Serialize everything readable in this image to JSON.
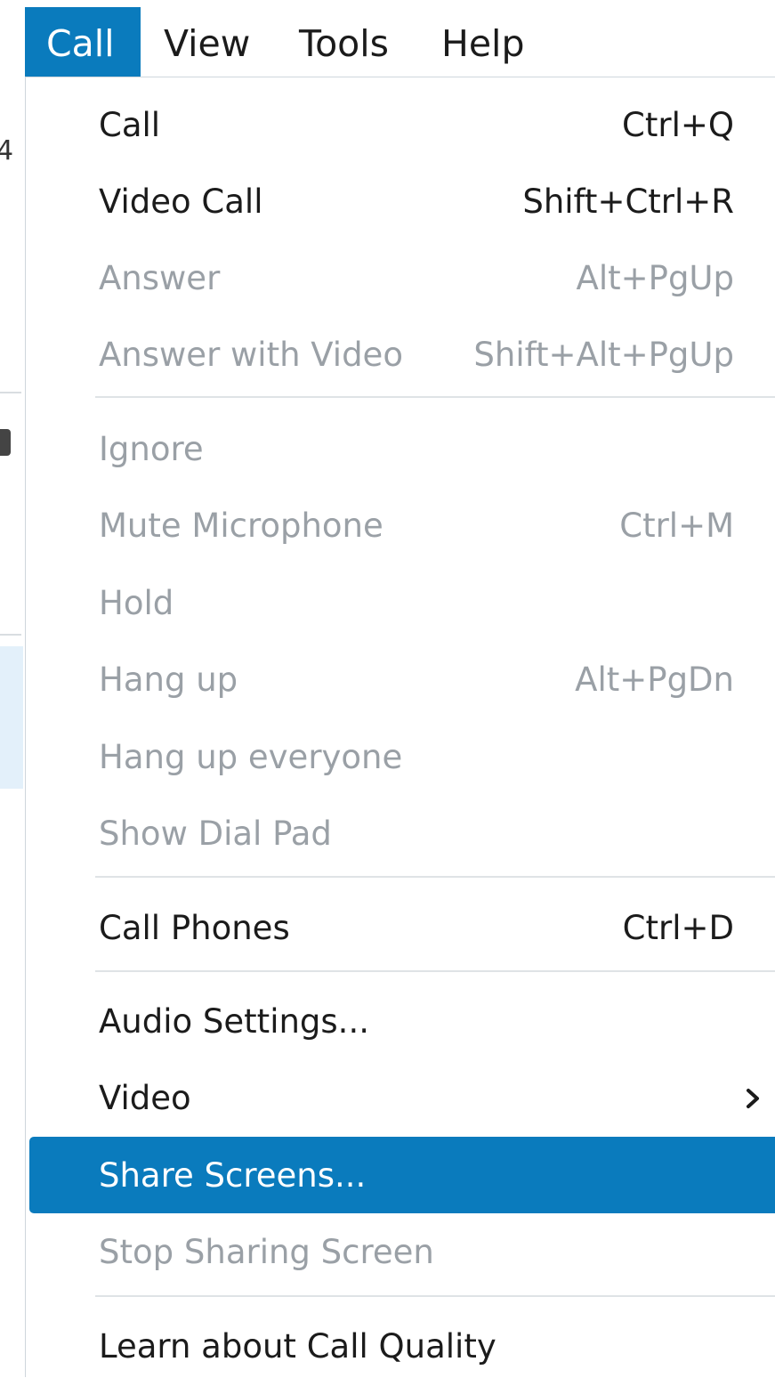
{
  "menubar": {
    "items": [
      {
        "label": "Call",
        "active": true
      },
      {
        "label": "View",
        "active": false
      },
      {
        "label": "Tools",
        "active": false
      },
      {
        "label": "Help",
        "active": false
      }
    ]
  },
  "background": {
    "fragment_text": "4"
  },
  "call_menu": {
    "items": {
      "call": {
        "label": "Call",
        "shortcut": "Ctrl+Q",
        "enabled": true
      },
      "video_call": {
        "label": "Video Call",
        "shortcut": "Shift+Ctrl+R",
        "enabled": true
      },
      "answer": {
        "label": "Answer",
        "shortcut": "Alt+PgUp",
        "enabled": false
      },
      "answer_with_video": {
        "label": "Answer with Video",
        "shortcut": "Shift+Alt+PgUp",
        "enabled": false
      },
      "ignore": {
        "label": "Ignore",
        "shortcut": "",
        "enabled": false
      },
      "mute_microphone": {
        "label": "Mute Microphone",
        "shortcut": "Ctrl+M",
        "enabled": false
      },
      "hold": {
        "label": "Hold",
        "shortcut": "",
        "enabled": false
      },
      "hang_up": {
        "label": "Hang up",
        "shortcut": "Alt+PgDn",
        "enabled": false
      },
      "hang_up_everyone": {
        "label": "Hang up everyone",
        "shortcut": "",
        "enabled": false
      },
      "show_dial_pad": {
        "label": "Show Dial Pad",
        "shortcut": "",
        "enabled": false
      },
      "call_phones": {
        "label": "Call Phones",
        "shortcut": "Ctrl+D",
        "enabled": true
      },
      "audio_settings": {
        "label": "Audio Settings...",
        "shortcut": "",
        "enabled": true
      },
      "video": {
        "label": "Video",
        "shortcut": "",
        "enabled": true,
        "has_submenu": true
      },
      "share_screens": {
        "label": "Share Screens...",
        "shortcut": "",
        "enabled": true,
        "highlighted": true
      },
      "stop_sharing_screen": {
        "label": "Stop Sharing Screen",
        "shortcut": "",
        "enabled": false
      },
      "learn_call_quality": {
        "label": "Learn about Call Quality",
        "shortcut": "",
        "enabled": true
      }
    }
  },
  "colors": {
    "accent": "#0a7bbd",
    "text": "#1b1b1b",
    "disabled_text": "#9aa0a6",
    "separator": "#dfe3e6"
  }
}
